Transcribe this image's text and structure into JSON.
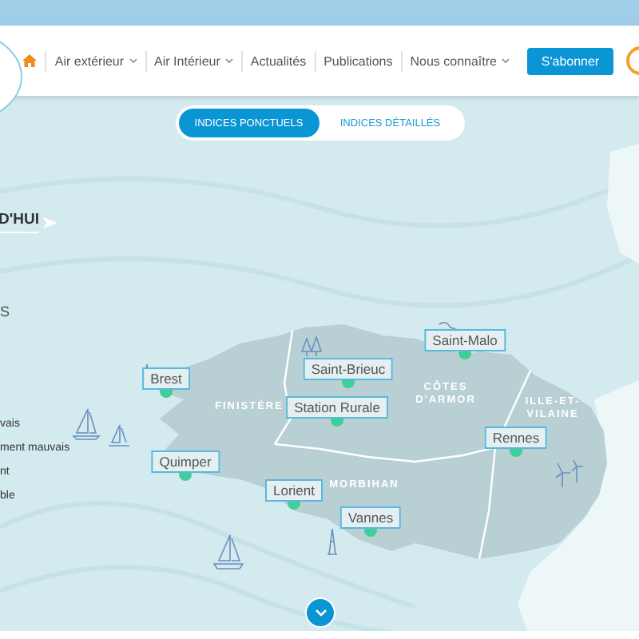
{
  "nav": {
    "items": [
      {
        "kind": "home"
      },
      {
        "kind": "link",
        "label": "Air extérieur",
        "dropdown": true
      },
      {
        "kind": "link",
        "label": "Air Intérieur",
        "dropdown": true
      },
      {
        "kind": "link",
        "label": "Actualités",
        "dropdown": false
      },
      {
        "kind": "link",
        "label": "Publications",
        "dropdown": false
      },
      {
        "kind": "link",
        "label": "Nous connaître",
        "dropdown": true
      }
    ],
    "subscribe": "S'abonner"
  },
  "toggle": [
    {
      "label": "INDICES PONCTUELS",
      "selected": true
    },
    {
      "label": "INDICES DÉTAILLÉS",
      "selected": false
    }
  ],
  "heading": "D'HUI",
  "subheading": "S",
  "legend": [
    "vais",
    "ment mauvais",
    "nt",
    "ble"
  ],
  "map": {
    "regions": [
      {
        "name": "FINISTÈRE"
      },
      {
        "name": "CÔTES D'ARMOR"
      },
      {
        "name": "ILLE-ET-VILAINE"
      },
      {
        "name": "MORBIHAN"
      }
    ],
    "stations": [
      {
        "name": "Brest"
      },
      {
        "name": "Quimper"
      },
      {
        "name": "Saint-Brieuc"
      },
      {
        "name": "Station Rurale"
      },
      {
        "name": "Saint-Malo"
      },
      {
        "name": "Rennes"
      },
      {
        "name": "Lorient"
      },
      {
        "name": "Vannes"
      }
    ]
  }
}
